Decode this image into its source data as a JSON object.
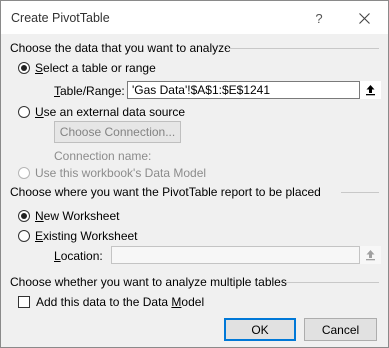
{
  "window": {
    "title": "Create PivotTable",
    "help_glyph": "?",
    "close_icon": "close-icon"
  },
  "data_section": {
    "title": "Choose the data that you want to analyze",
    "option_table": {
      "prefix": "",
      "underline": "S",
      "suffix": "elect a table or range",
      "checked": true
    },
    "table_range": {
      "label_underline": "T",
      "label_rest": "able/Range:",
      "value": "'Gas Data'!$A$1:$E$1241"
    },
    "option_external": {
      "prefix": "",
      "underline": "U",
      "suffix": "se an external data source",
      "checked": false
    },
    "choose_connection_button": "Choose Connection...",
    "connection_name_label": "Connection name:",
    "option_data_model": {
      "label": "Use this workbook's Data Model",
      "checked": false,
      "disabled": true
    }
  },
  "placement_section": {
    "title": "Choose where you want the PivotTable report to be placed",
    "option_new": {
      "prefix": "",
      "underline": "N",
      "suffix": "ew Worksheet",
      "checked": true
    },
    "option_existing": {
      "prefix": "",
      "underline": "E",
      "suffix": "xisting Worksheet",
      "checked": false
    },
    "location": {
      "label_underline": "L",
      "label_rest": "ocation:",
      "value": ""
    }
  },
  "multi_section": {
    "title": "Choose whether you want to analyze multiple tables",
    "add_to_model": {
      "prefix": "Add this data to the Data ",
      "underline": "M",
      "suffix": "odel",
      "checked": false
    }
  },
  "buttons": {
    "ok": "OK",
    "cancel": "Cancel"
  }
}
